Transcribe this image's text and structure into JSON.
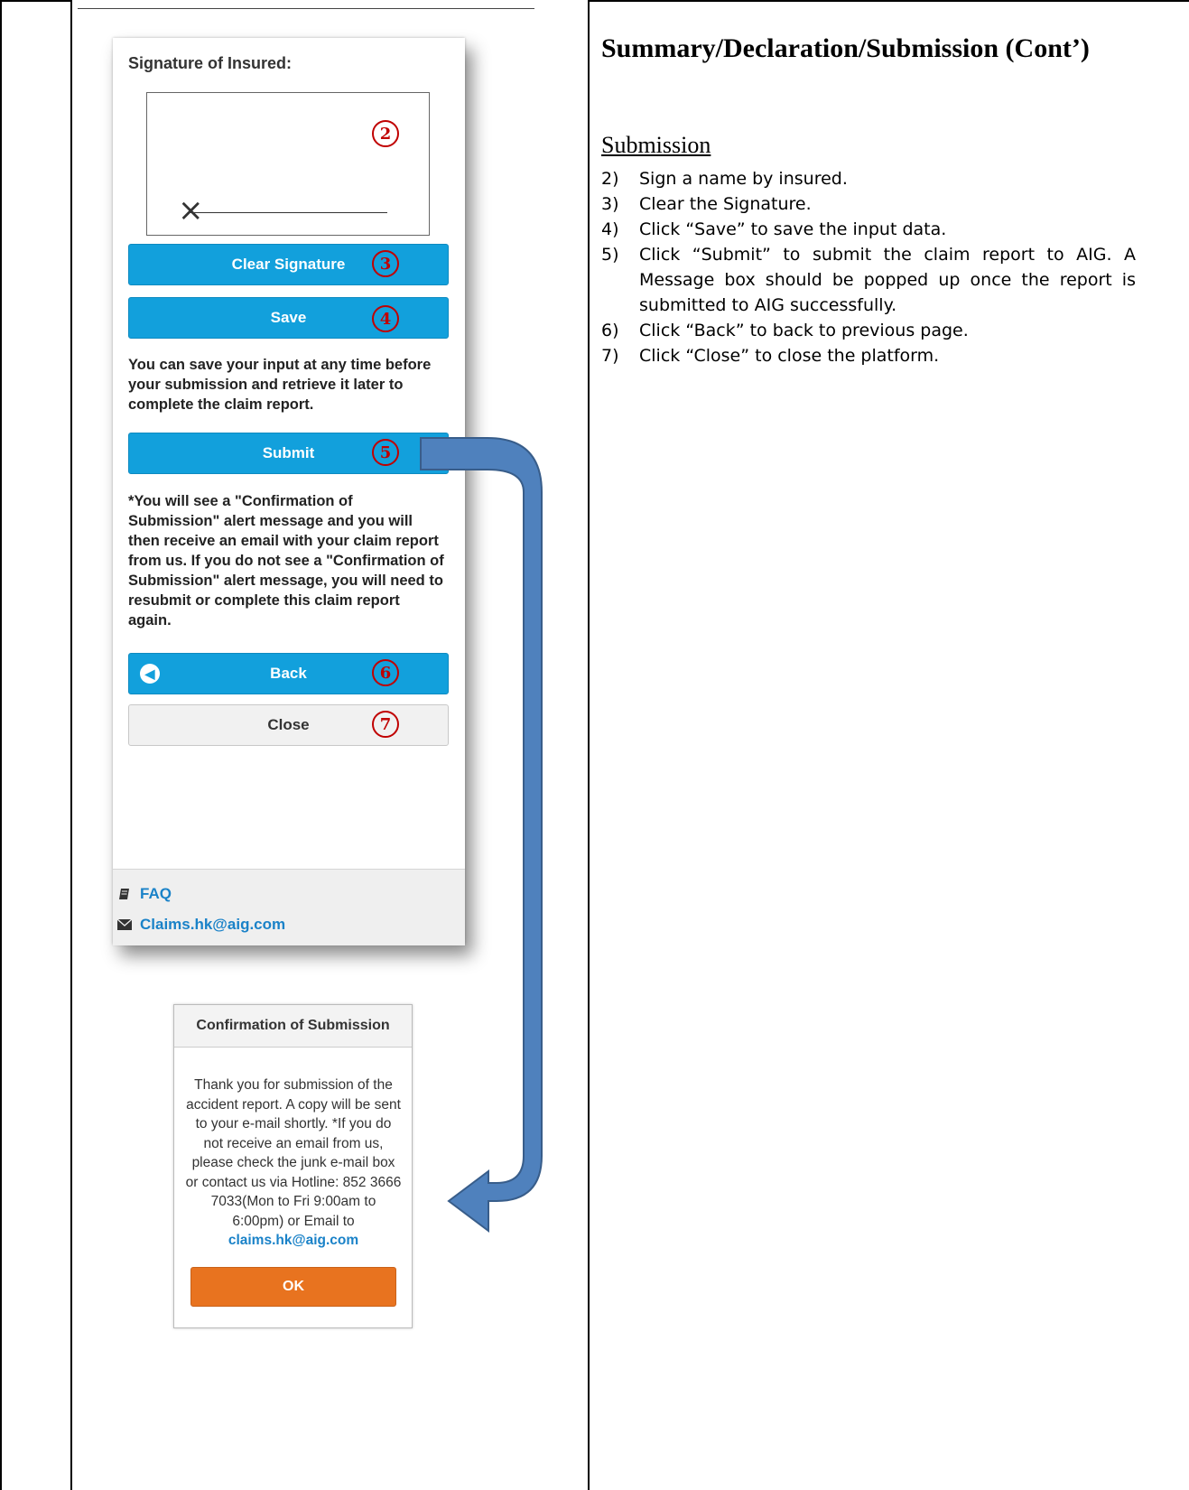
{
  "left_panel": {
    "signature_title": "Signature of Insured:",
    "signature_mark": "×",
    "clear_signature_label": "Clear Signature",
    "save_label": "Save",
    "save_note": "You can save your input at any time before your submission and retrieve it later to complete the claim report.",
    "submit_label": "Submit",
    "submit_note": "*You will see a \"Confirmation of Submission\" alert message and you will then receive an email with your claim report from us. If you do not see a \"Confirmation of Submission\" alert message, you will need to resubmit or complete this claim report again.",
    "back_label": "Back",
    "close_label": "Close",
    "footer": {
      "faq_label": "FAQ",
      "email_label": "Claims.hk@aig.com"
    }
  },
  "markers": {
    "m2": "2",
    "m3": "3",
    "m4": "4",
    "m5": "5",
    "m6": "6",
    "m7": "7"
  },
  "dialog": {
    "title": "Confirmation of Submission",
    "body": "Thank you for submission of the accident report. A copy will be sent to your e-mail shortly. *If you do not receive an email from us, please check the junk e-mail box or contact us via Hotline: 852 3666 7033(Mon to Fri 9:00am to 6:00pm) or Email to ",
    "email": "claims.hk@aig.com",
    "ok_label": "OK"
  },
  "right_panel": {
    "heading": "Summary/Declaration/Submission (Cont’)",
    "subheading": "Submission",
    "steps": [
      {
        "num": "2)",
        "text": "Sign a name by insured."
      },
      {
        "num": "3)",
        "text": "Clear the Signature."
      },
      {
        "num": "4)",
        "text": "Click “Save” to save the input data."
      },
      {
        "num": "5)",
        "text": "Click “Submit” to submit the claim report to AIG. A Message box should be popped up once the report is submitted to AIG successfully."
      },
      {
        "num": "6)",
        "text": "Click “Back” to back to previous page."
      },
      {
        "num": "7)",
        "text": "Click “Close” to close the platform."
      }
    ]
  },
  "colors": {
    "button_blue": "#12a0dc",
    "ok_orange": "#e8731f",
    "marker_red": "#c00000",
    "flow_arrow": "#4f81bd",
    "link_blue": "#1a82c8"
  }
}
